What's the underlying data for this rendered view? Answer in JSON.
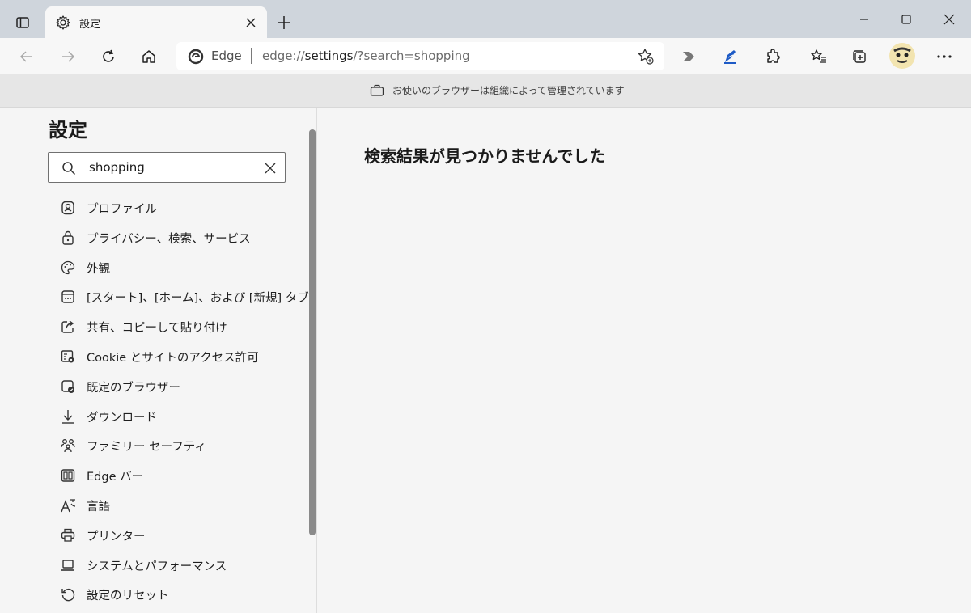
{
  "tab": {
    "title": "設定"
  },
  "address": {
    "site_name": "Edge",
    "url_scheme": "edge://",
    "url_host": "settings",
    "url_path": "/?search=shopping"
  },
  "banner": {
    "text": "お使いのブラウザーは組織によって管理されています"
  },
  "sidebar": {
    "title": "設定",
    "search": {
      "value": "shopping"
    },
    "items": [
      {
        "label": "プロファイル",
        "icon": "profile-icon"
      },
      {
        "label": "プライバシー、検索、サービス",
        "icon": "lock-icon"
      },
      {
        "label": "外観",
        "icon": "palette-icon"
      },
      {
        "label": "[スタート]、[ホーム]、および [新規] タブ",
        "icon": "new-tab-icon"
      },
      {
        "label": "共有、コピーして貼り付け",
        "icon": "share-icon"
      },
      {
        "label": "Cookie とサイトのアクセス許可",
        "icon": "site-permissions-icon"
      },
      {
        "label": "既定のブラウザー",
        "icon": "default-browser-icon"
      },
      {
        "label": "ダウンロード",
        "icon": "download-icon"
      },
      {
        "label": "ファミリー セーフティ",
        "icon": "family-icon"
      },
      {
        "label": "Edge バー",
        "icon": "edge-bar-icon"
      },
      {
        "label": "言語",
        "icon": "language-icon"
      },
      {
        "label": "プリンター",
        "icon": "printer-icon"
      },
      {
        "label": "システムとパフォーマンス",
        "icon": "laptop-icon"
      },
      {
        "label": "設定のリセット",
        "icon": "reset-icon"
      }
    ]
  },
  "main": {
    "no_results": "検索結果が見つかりませんでした"
  },
  "colors": {
    "titlebar": "#cfd5dc",
    "toolbar": "#f7f7f7",
    "banner": "#e6e6e6",
    "page": "#f5f5f5",
    "accent": "#1e5bc6"
  }
}
